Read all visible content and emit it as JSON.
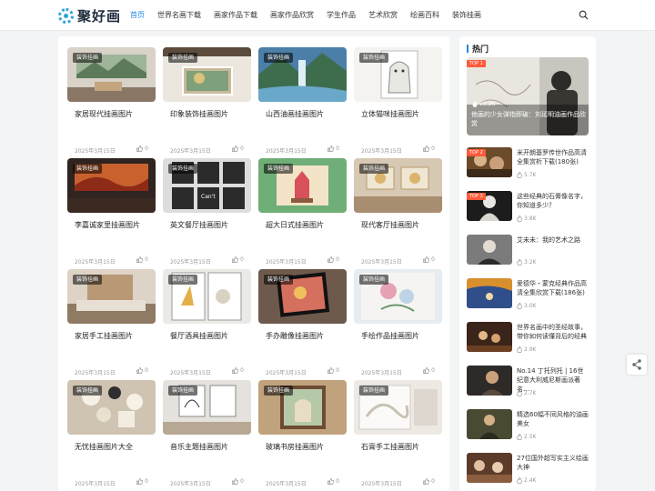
{
  "header": {
    "logo_text": "聚好画",
    "nav": [
      "首页",
      "世界名画下载",
      "画家作品下载",
      "画家作品欣赏",
      "学生作品",
      "艺术欣赏",
      "绘画百科",
      "装饰挂画"
    ],
    "active_index": 0
  },
  "grid": {
    "tag": "装饰挂画",
    "cards": [
      {
        "title": "家居现代挂画图片",
        "date": "2025年3月15日",
        "likes": "0"
      },
      {
        "title": "印象装饰挂画图片",
        "date": "2025年3月15日",
        "likes": "0"
      },
      {
        "title": "山西油画挂画图片",
        "date": "2025年3月15日",
        "likes": "0"
      },
      {
        "title": "立体猫咪挂画图片",
        "date": "2025年3月15日",
        "likes": "0"
      },
      {
        "title": "李嘉诚家里挂画图片",
        "date": "2025年3月15日",
        "likes": "0"
      },
      {
        "title": "英文餐厅挂画图片",
        "date": "2025年3月15日",
        "likes": "0"
      },
      {
        "title": "超大日式挂画图片",
        "date": "2025年3月15日",
        "likes": "0"
      },
      {
        "title": "现代客厅挂画图片",
        "date": "2025年3月15日",
        "likes": "0"
      },
      {
        "title": "家居手工挂画图片",
        "date": "2025年3月15日",
        "likes": "0"
      },
      {
        "title": "餐厅酒具挂画图片",
        "date": "2025年3月15日",
        "likes": "0"
      },
      {
        "title": "手办雕像挂画图片",
        "date": "2025年3月15日",
        "likes": "0"
      },
      {
        "title": "手绘作品挂画图片",
        "date": "2025年3月15日",
        "likes": "0"
      },
      {
        "title": "无忧挂画图片大全",
        "date": "2025年3月15日",
        "likes": "0"
      },
      {
        "title": "音乐主题挂画图片",
        "date": "2025年3月15日",
        "likes": "0"
      },
      {
        "title": "玻璃书房挂画图片",
        "date": "2025年3月15日",
        "likes": "0"
      },
      {
        "title": "石膏手工挂画图片",
        "date": "2025年3月15日",
        "likes": "0"
      }
    ]
  },
  "sidebar": {
    "heading": "热门",
    "hero": {
      "badge": "TOP 1",
      "views": "13.2K",
      "title": "他画的少女弹指即破：刘延明油画作品欣赏"
    },
    "items": [
      {
        "badge": "TOP 2",
        "title": "米开朗基罗传世作品高清全集赏析下载(180张)",
        "views": "5.7K"
      },
      {
        "badge": "TOP 3",
        "title": "这些经典的石膏像名字，你知道多少？",
        "views": "3.8K"
      },
      {
        "badge": "",
        "title": "艾未未：我的艺术之路",
        "views": "3.2K"
      },
      {
        "badge": "",
        "title": "爱德华・蒙克经典作品高清全集欣赏下载(186张)",
        "views": "3.0K"
      },
      {
        "badge": "",
        "title": "世界名画中的圣经故事，带你如何读懂背后的经典",
        "views": "2.9K"
      },
      {
        "badge": "",
        "title": "No.14 丁托列托 | 16世纪意大利威尼斯画派著名…",
        "views": "2.7K"
      },
      {
        "badge": "",
        "title": "精选60幅不同风格的油画美女",
        "views": "2.5K"
      },
      {
        "badge": "",
        "title": "27位国外超写实主义绘画大神",
        "views": "2.4K"
      }
    ]
  }
}
